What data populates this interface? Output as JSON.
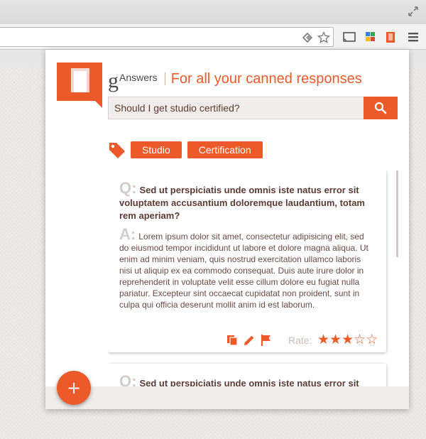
{
  "browser": {
    "icons": [
      "restore-icon",
      "page-action-icon",
      "bookmark-star-icon",
      "cast-icon",
      "puzzle-extension-icon",
      "ganswers-extension-icon",
      "chrome-menu-icon"
    ]
  },
  "header": {
    "brand_g": "g",
    "brand_name": "Answers",
    "tagline": "For all your canned responses"
  },
  "search": {
    "value": "Should I get studio certified?",
    "icon": "search-icon"
  },
  "tags": [
    "Studio",
    "Certification"
  ],
  "cards": [
    {
      "q_letter": "Q:",
      "question": "Sed ut perspiciatis unde omnis iste natus error sit voluptatem accusantium doloremque laudantium, totam rem aperiam?",
      "a_letter": "A:",
      "answer": "Lorem ipsum dolor sit amet, consectetur adipisicing elit, sed do eiusmod tempor incididunt ut labore et dolore magna aliqua. Ut enim ad minim veniam, quis nostrud exercitation ullamco laboris nisi ut aliquip ex ea commodo consequat. Duis aute irure dolor in reprehenderit in voluptate velit esse cillum dolore eu fugiat nulla pariatur. Excepteur sint occaecat cupidatat non proident, sunt in culpa qui officia deserunt mollit anim id est laborum.",
      "rate_label": "Rate:",
      "rating": 3,
      "rating_max": 5
    },
    {
      "q_letter": "Q:",
      "question": "Sed ut perspiciatis unde omnis iste natus error sit"
    }
  ],
  "fab_label": "+",
  "colors": {
    "accent": "#ec5a2a",
    "text_dark": "#5a3c34",
    "muted": "#d5cbc8"
  }
}
